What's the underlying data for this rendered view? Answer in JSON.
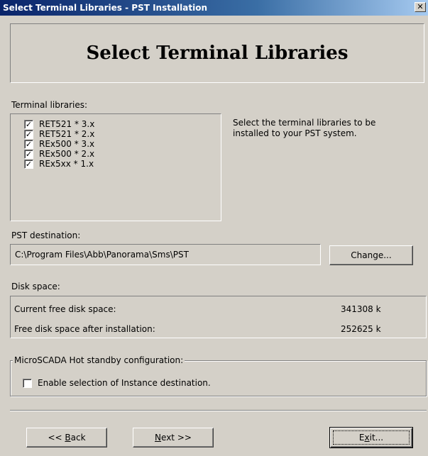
{
  "window": {
    "title": "Select Terminal Libraries - PST Installation",
    "close_glyph": "✕"
  },
  "header": {
    "title": "Select Terminal Libraries"
  },
  "libraries": {
    "label": "Terminal libraries:",
    "check_glyph": "✓",
    "items": [
      {
        "label": "RET521 * 3.x",
        "checked": true
      },
      {
        "label": "RET521 * 2.x",
        "checked": true
      },
      {
        "label": "REx500 * 3.x",
        "checked": true
      },
      {
        "label": "REx500 * 2.x",
        "checked": true
      },
      {
        "label": "REx5xx * 1.x",
        "checked": true
      }
    ],
    "description": "Select the terminal libraries to be installed to your PST system."
  },
  "destination": {
    "label": "PST destination:",
    "path": "C:\\Program Files\\Abb\\Panorama\\Sms\\PST",
    "change_button": "Change..."
  },
  "disk": {
    "label": "Disk space:",
    "current_label": "Current free disk space:",
    "current_value": "341308 k",
    "after_label": "Free disk space after installation:",
    "after_value": "252625 k"
  },
  "hot_standby": {
    "legend": "MicroSCADA Hot standby configuration:",
    "checkbox_label": "Enable selection of Instance destination.",
    "checked": false
  },
  "buttons": {
    "back_prefix": "<< ",
    "back_mnemonic": "B",
    "back_rest": "ack",
    "next_mnemonic": "N",
    "next_rest": "ext >>",
    "exit_prefix": "E",
    "exit_mnemonic": "x",
    "exit_rest": "it..."
  }
}
